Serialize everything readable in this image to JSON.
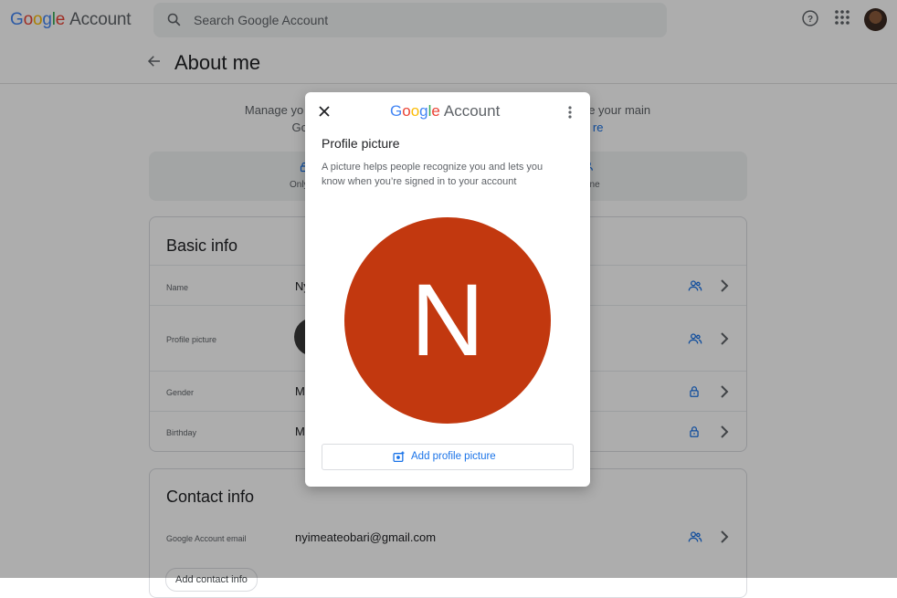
{
  "header": {
    "logo_google": "Google",
    "logo_account": "Account",
    "search_placeholder": "Search Google Account"
  },
  "page": {
    "title": "About me",
    "manage_line1_left": "Manage yo",
    "manage_line1_right": "e your main",
    "manage_line2_left": "Go",
    "manage_line2_right": "re"
  },
  "privacy": {
    "left_label": "Only",
    "right_label": "one"
  },
  "basic_info": {
    "title": "Basic info",
    "rows": [
      {
        "label": "Name",
        "value": "Ny"
      },
      {
        "label": "Profile picture",
        "value": ""
      },
      {
        "label": "Gender",
        "value": "M"
      },
      {
        "label": "Birthday",
        "value": "M"
      }
    ]
  },
  "contact_info": {
    "title": "Contact info",
    "email_label": "Google Account email",
    "email_value": "nyimeateobari@gmail.com",
    "add_contact": "Add contact info"
  },
  "dialog": {
    "logo_google": "Google",
    "logo_account": "Account",
    "title": "Profile picture",
    "description": "A picture helps people recognize you and lets you know when you’re signed in to your account",
    "avatar_letter": "N",
    "avatar_color": "#c2380f",
    "add_button": "Add profile picture"
  },
  "colors": {
    "accent": "#1a73e8",
    "scrim": "rgba(0,0,0,0.32)"
  }
}
